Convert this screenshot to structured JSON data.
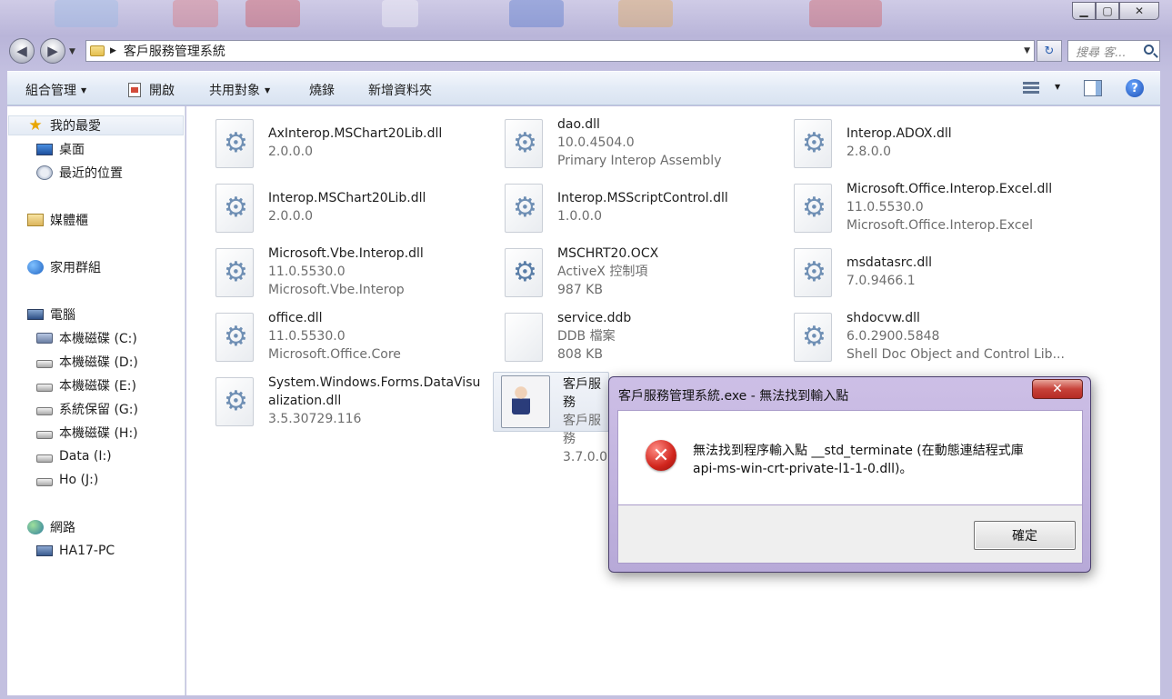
{
  "window": {
    "caption": {
      "minimize": "▁",
      "maximize": "▢",
      "close": "✕"
    }
  },
  "address": {
    "back": "◀",
    "forward": "▶",
    "separator": "▶",
    "path": "客戶服務管理系統",
    "refresh": "↻",
    "search_placeholder": "搜尋 客..."
  },
  "toolbar": {
    "organize": "組合管理",
    "open": "開啟",
    "share": "共用對象",
    "burn": "燒錄",
    "new_folder": "新增資料夾",
    "help": "?"
  },
  "sidebar": {
    "favorites": "我的最愛",
    "desktop": "桌面",
    "recent": "最近的位置",
    "libraries": "媒體櫃",
    "homegroup": "家用群組",
    "computer": "電腦",
    "drives": [
      "本機磁碟 (C:)",
      "本機磁碟 (D:)",
      "本機磁碟 (E:)",
      "系統保留 (G:)",
      "本機磁碟 (H:)",
      "Data (I:)",
      "Ho (J:)"
    ],
    "network": "網路",
    "network_pc": "HA17-PC"
  },
  "files": [
    {
      "icon": "dll-file-icon",
      "name": "AxInterop.MSChart20Lib.dll",
      "meta1": "2.0.0.0",
      "meta2": ""
    },
    {
      "icon": "dll-file-icon",
      "name": "dao.dll",
      "meta1": "10.0.4504.0",
      "meta2": "Primary Interop Assembly"
    },
    {
      "icon": "dll-file-icon",
      "name": "Interop.ADOX.dll",
      "meta1": "2.8.0.0",
      "meta2": ""
    },
    {
      "icon": "dll-file-icon",
      "name": "Interop.MSChart20Lib.dll",
      "meta1": "2.0.0.0",
      "meta2": ""
    },
    {
      "icon": "dll-file-icon",
      "name": "Interop.MSScriptControl.dll",
      "meta1": "1.0.0.0",
      "meta2": ""
    },
    {
      "icon": "dll-file-icon",
      "name": "Microsoft.Office.Interop.Excel.dll",
      "meta1": "11.0.5530.0",
      "meta2": "Microsoft.Office.Interop.Excel"
    },
    {
      "icon": "dll-file-icon",
      "name": "Microsoft.Vbe.Interop.dll",
      "meta1": "11.0.5530.0",
      "meta2": "Microsoft.Vbe.Interop"
    },
    {
      "icon": "ocx-file-icon",
      "name": "MSCHRT20.OCX",
      "meta1": "ActiveX 控制項",
      "meta2": "987 KB"
    },
    {
      "icon": "dll-file-icon",
      "name": "msdatasrc.dll",
      "meta1": "7.0.9466.1",
      "meta2": ""
    },
    {
      "icon": "dll-file-icon",
      "name": "office.dll",
      "meta1": "11.0.5530.0",
      "meta2": "Microsoft.Office.Core"
    },
    {
      "icon": "ddb-file-icon",
      "name": "service.ddb",
      "meta1": "DDB 檔案",
      "meta2": "808 KB"
    },
    {
      "icon": "dll-file-icon",
      "name": "shdocvw.dll",
      "meta1": "6.0.2900.5848",
      "meta2": "Shell Doc Object and Control Lib..."
    },
    {
      "icon": "dll-file-icon",
      "name": "System.Windows.Forms.DataVisu",
      "name2": "alization.dll",
      "meta1": "3.5.30729.116",
      "meta2": ""
    },
    {
      "icon": "app-file-icon",
      "name": "客戶服務",
      "meta1": "客戶服務",
      "meta2": "3.7.0.0"
    }
  ],
  "dialog": {
    "title": "客戶服務管理系統.exe - 無法找到輸入點",
    "close": "✕",
    "icon_glyph": "✕",
    "message_line1": "無法找到程序輸入點 __std_terminate (在動態連結程式庫",
    "message_line2": "api-ms-win-crt-private-l1-1-0.dll)。",
    "ok": "確定"
  }
}
